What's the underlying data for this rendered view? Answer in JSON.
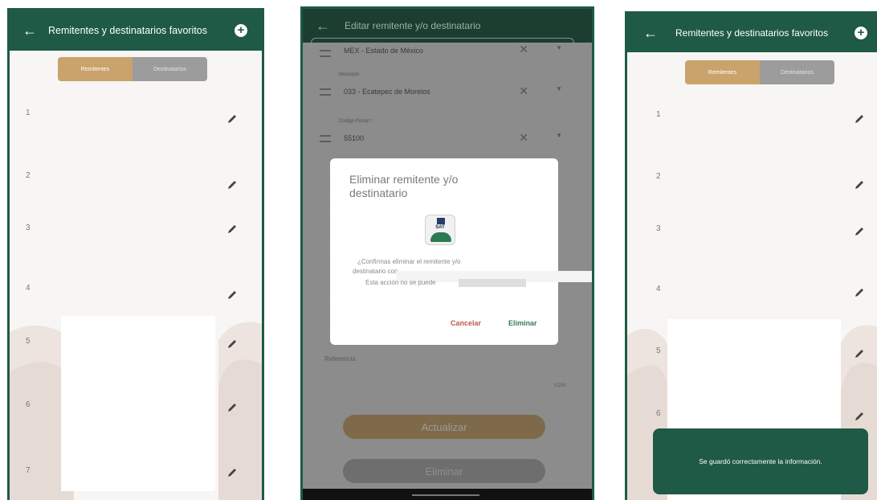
{
  "screen1": {
    "title": "Remitentes y destinatarios favoritos",
    "back_icon": "arrow-left-icon",
    "add_icon": "plus-circle-icon",
    "tabs": [
      "Remitentes",
      "Destinatarios"
    ],
    "rows": [
      "1",
      "2",
      "3",
      "4",
      "5",
      "6",
      "7"
    ]
  },
  "screen2": {
    "title": "Editar remitente y/o destinatario",
    "fields": [
      {
        "label": "",
        "value": "MEX - Estado de México"
      },
      {
        "label": "Municipio",
        "value": "033 - Ecatepec de Morelos"
      },
      {
        "label": "Código Postal *",
        "value": "55100"
      }
    ],
    "reference_label": "Referencia",
    "counter": "0/250",
    "update_button": "Actualizar",
    "delete_button": "Eliminar",
    "dialog": {
      "title": "Eliminar remitente y/o destinatario",
      "logo_text": "SAT",
      "message_line1": "¿Confirmas eliminar el remitente y/o",
      "message_line2": "destinatario con",
      "message_line3": "Esta acción no se puede",
      "cancel": "Cancelar",
      "confirm": "Eliminar"
    }
  },
  "screen3": {
    "title": "Remitentes y destinatarios favoritos",
    "tabs": [
      "Remitentes",
      "Destinatarios"
    ],
    "rows": [
      "1",
      "2",
      "3",
      "4",
      "5",
      "6"
    ],
    "toast": "Se guardó correctamente la información."
  },
  "colors": {
    "green": "#1e5a45",
    "gold": "#c9a36b",
    "gray_tab": "#9c9c9c"
  }
}
